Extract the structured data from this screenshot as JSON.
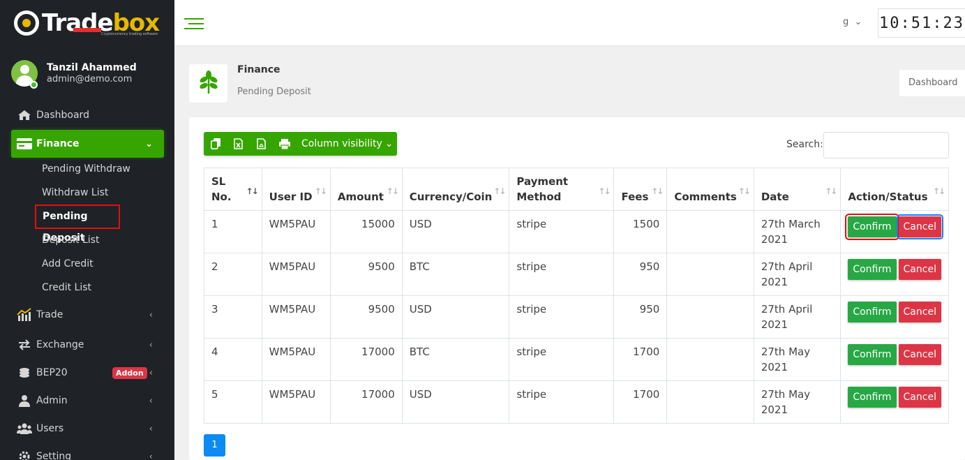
{
  "brand": {
    "name_main": "Trade",
    "name_accent": "box",
    "tagline": "Cryptocurrency trading software"
  },
  "user": {
    "name": "Tanzil Ahammed",
    "email": "admin@demo.com"
  },
  "sidebar": {
    "items": [
      {
        "label": "Dashboard",
        "icon": "home-icon"
      },
      {
        "label": "Finance",
        "icon": "credit-card-icon"
      },
      {
        "label": "Trade",
        "icon": "chart-icon"
      },
      {
        "label": "Exchange",
        "icon": "exchange-icon"
      },
      {
        "label": "BEP20",
        "icon": "coins-icon",
        "badge": "Addon"
      },
      {
        "label": "Admin",
        "icon": "user-icon"
      },
      {
        "label": "Users",
        "icon": "users-icon"
      },
      {
        "label": "Setting",
        "icon": "gear-icon"
      }
    ],
    "finance_sub": [
      "Pending Withdraw",
      "Withdraw List",
      "Pending Deposit",
      "Deposit List",
      "Add Credit",
      "Credit List"
    ]
  },
  "topbar": {
    "lang": "g",
    "clock": "10:51:23"
  },
  "page": {
    "section": "Finance",
    "title": "Pending Deposit",
    "dashboard_button": "Dashboard"
  },
  "toolbar": {
    "column_visibility": "Column visibility",
    "search_label": "Search:"
  },
  "table": {
    "headers": [
      "SL No.",
      "User ID",
      "Amount",
      "Currency/Coin",
      "Payment Method",
      "Fees",
      "Comments",
      "Date",
      "Action/Status"
    ],
    "rows": [
      {
        "sl": "1",
        "user_id": "WM5PAU",
        "amount": "15000",
        "currency": "USD",
        "method": "stripe",
        "fees": "1500",
        "comments": "",
        "date": "27th March 2021"
      },
      {
        "sl": "2",
        "user_id": "WM5PAU",
        "amount": "9500",
        "currency": "BTC",
        "method": "stripe",
        "fees": "950",
        "comments": "",
        "date": "27th April 2021"
      },
      {
        "sl": "3",
        "user_id": "WM5PAU",
        "amount": "9500",
        "currency": "USD",
        "method": "stripe",
        "fees": "950",
        "comments": "",
        "date": "27th April 2021"
      },
      {
        "sl": "4",
        "user_id": "WM5PAU",
        "amount": "17000",
        "currency": "BTC",
        "method": "stripe",
        "fees": "1700",
        "comments": "",
        "date": "27th May 2021"
      },
      {
        "sl": "5",
        "user_id": "WM5PAU",
        "amount": "17000",
        "currency": "USD",
        "method": "stripe",
        "fees": "1700",
        "comments": "",
        "date": "27th May 2021"
      }
    ],
    "confirm_label": "Confirm",
    "cancel_label": "Cancel"
  },
  "pagination": {
    "current": "1"
  },
  "colors": {
    "accent": "#36a500",
    "sidebar_bg": "#1f2227",
    "confirm": "#28a745",
    "cancel": "#dc3545",
    "page_active": "#0d8bf2",
    "highlight": "#e01010"
  }
}
